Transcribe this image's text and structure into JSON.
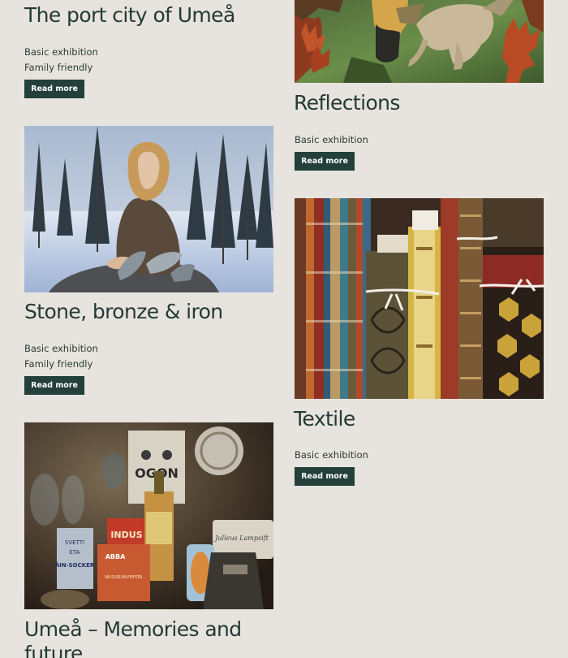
{
  "exhibitions": {
    "port_city": {
      "title": "The port city of Umeå",
      "tags": [
        "Basic exhibition",
        "Family friendly"
      ],
      "button": "Read more"
    },
    "reflections": {
      "title": "Reflections",
      "tags": [
        "Basic exhibition"
      ],
      "button": "Read more"
    },
    "stone": {
      "title": "Stone, bronze & iron",
      "tags": [
        "Basic exhibition",
        "Family friendly"
      ],
      "button": "Read more"
    },
    "textile": {
      "title": "Textile",
      "tags": [
        "Basic exhibition"
      ],
      "button": "Read more"
    },
    "memories": {
      "title_line1": "Umeå – Memories and",
      "title_line2": "future"
    }
  },
  "product_labels": {
    "tin_left": "SVETTI",
    "tin_left2": "ETA",
    "tin_left3": "ÄIN-SOCKER",
    "box_text": "OGON",
    "can_text": "INDUS",
    "abba": "ABBA",
    "fisk": "VA-SUSUM-FRYSTA",
    "sign": "Julleus Lampsift"
  },
  "colors": {
    "background": "#e7e3de",
    "title": "#243a34",
    "button_bg": "#23403a",
    "button_text": "#ffffff"
  }
}
